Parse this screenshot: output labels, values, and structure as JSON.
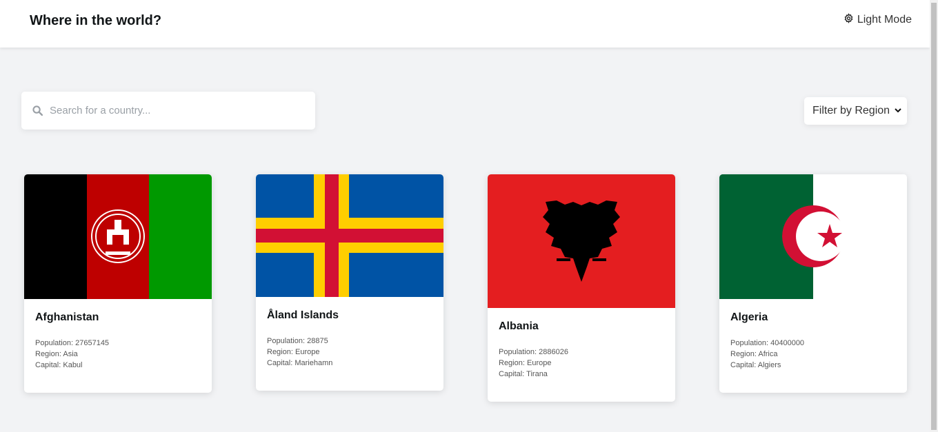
{
  "header": {
    "title": "Where in the world?",
    "mode_label": "Light Mode",
    "mode_icon": "gear-icon"
  },
  "search": {
    "placeholder": "Search for a country...",
    "value": "",
    "icon": "search-icon"
  },
  "filter": {
    "selected": "Filter by Region",
    "icon": "chevron-down-icon"
  },
  "labels": {
    "population": "Population: ",
    "region": "Region: ",
    "capital": "Capital: "
  },
  "countries": [
    {
      "name": "Afghanistan",
      "population": "27657145",
      "region": "Asia",
      "capital": "Kabul",
      "flag_colors": [
        "#000000",
        "#be0000",
        "#009900"
      ]
    },
    {
      "name": "Åland Islands",
      "population": "28875",
      "region": "Europe",
      "capital": "Mariehamn",
      "flag_colors": [
        "#0053a5",
        "#ffce00",
        "#d21034"
      ]
    },
    {
      "name": "Albania",
      "population": "2886026",
      "region": "Europe",
      "capital": "Tirana",
      "flag_colors": [
        "#e41e20",
        "#000000"
      ]
    },
    {
      "name": "Algeria",
      "population": "40400000",
      "region": "Africa",
      "capital": "Algiers",
      "flag_colors": [
        "#006233",
        "#ffffff",
        "#d21034"
      ]
    }
  ]
}
